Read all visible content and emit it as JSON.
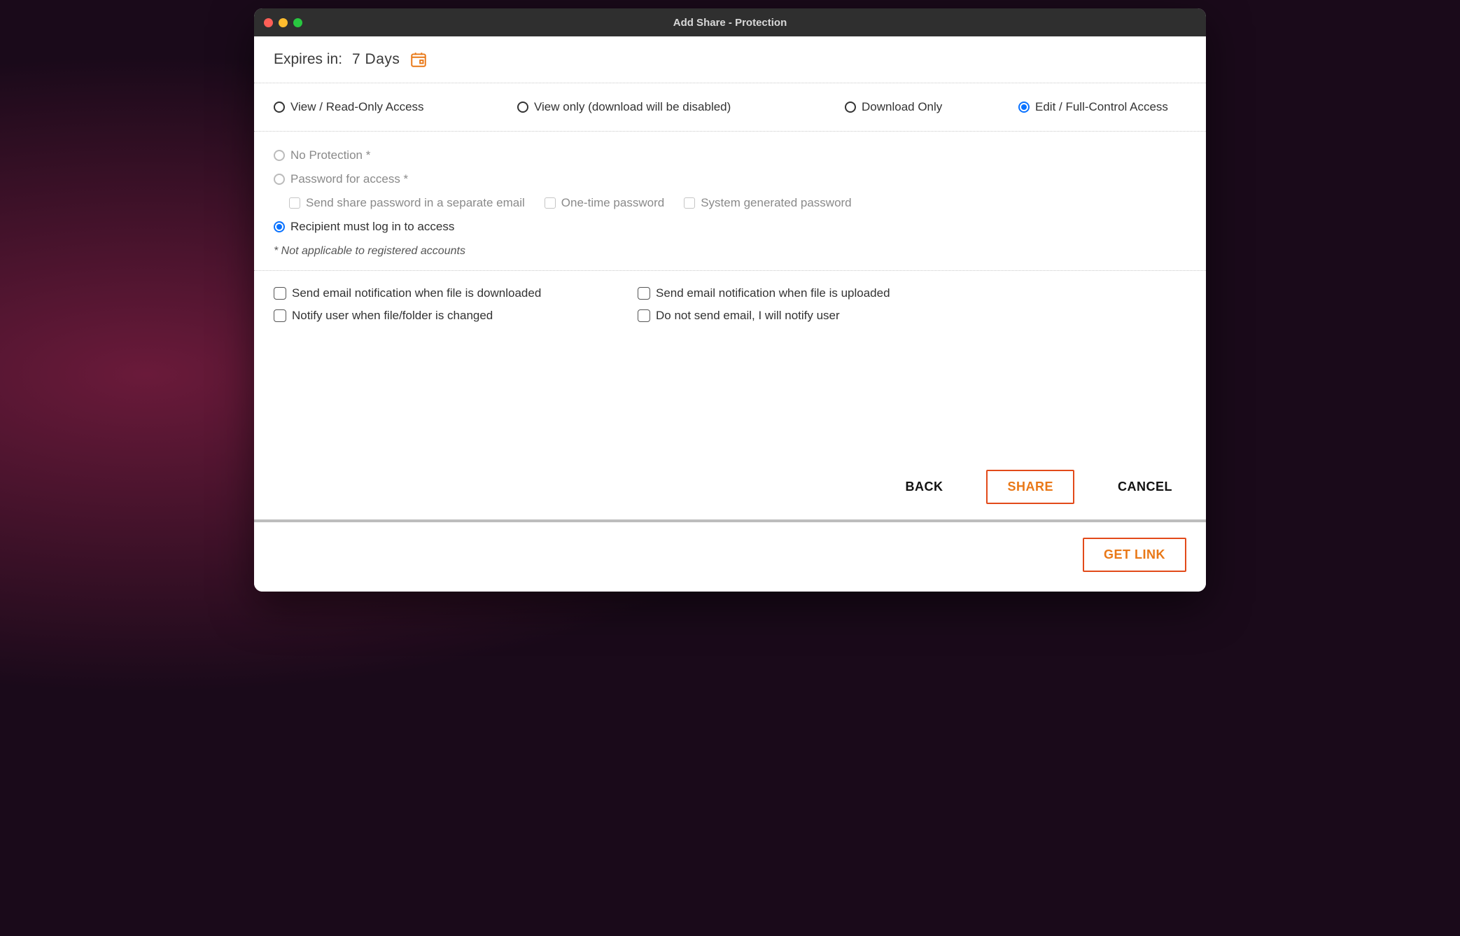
{
  "window": {
    "title": "Add Share - Protection"
  },
  "expires": {
    "label": "Expires in:",
    "value": "7 Days"
  },
  "access": {
    "options": [
      {
        "label": "View / Read-Only Access",
        "selected": false
      },
      {
        "label": "View only (download will be disabled)",
        "selected": false
      },
      {
        "label": "Download Only",
        "selected": false
      },
      {
        "label": "Edit / Full-Control Access",
        "selected": true
      }
    ]
  },
  "protection": {
    "no_protection": "No Protection *",
    "password": "Password for access *",
    "sub": {
      "separate_email": "Send share password in a separate email",
      "one_time": "One-time password",
      "system_gen": "System generated password"
    },
    "recipient_login": "Recipient must log in to access",
    "note": "* Not applicable to registered accounts"
  },
  "notify": {
    "downloaded": "Send email notification when file is downloaded",
    "uploaded": "Send email notification when file is uploaded",
    "changed": "Notify user when file/folder is changed",
    "no_email": "Do not send email, I will notify user"
  },
  "buttons": {
    "back": "BACK",
    "share": "SHARE",
    "cancel": "CANCEL",
    "get_link": "GET LINK"
  }
}
